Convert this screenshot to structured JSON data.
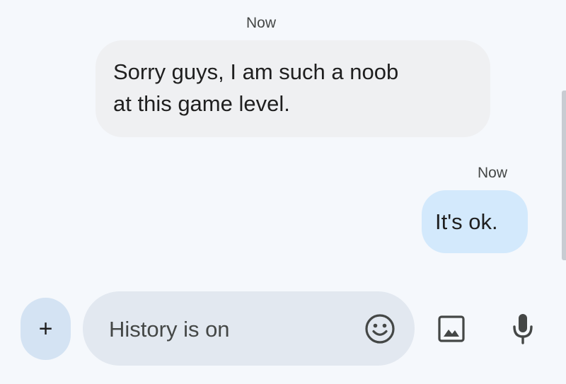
{
  "conversation": {
    "messages": [
      {
        "direction": "incoming",
        "timestamp": "Now",
        "lines": [
          "Sorry guys, I am such a noob",
          "at this game level."
        ]
      },
      {
        "direction": "outgoing",
        "timestamp": "Now",
        "lines": [
          "It's ok."
        ]
      }
    ]
  },
  "compose": {
    "placeholder": "History is on",
    "plus_label": "+",
    "icons": {
      "emoji": "emoji-icon",
      "image": "image-icon",
      "mic": "microphone-icon"
    }
  },
  "colors": {
    "background": "#f5f8fc",
    "incoming_bubble": "#eff0f2",
    "outgoing_bubble": "#d3e9fc",
    "compose_field": "#e2e8f0",
    "plus_button": "#d4e3f3",
    "icon": "#444746"
  }
}
